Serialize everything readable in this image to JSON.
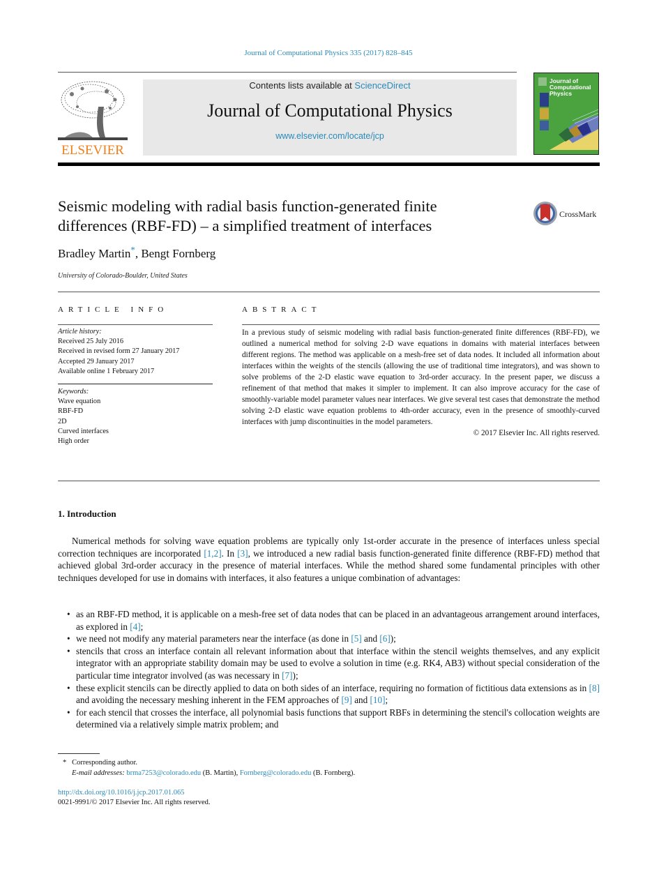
{
  "header": {
    "journal_ref": "Journal of Computational Physics 335 (2017) 828–845",
    "contents_prefix": "Contents lists available at ",
    "contents_link": "ScienceDirect",
    "journal_title": "Journal of Computational Physics",
    "journal_url": "www.elsevier.com/locate/jcp",
    "publisher_logo_text": "ELSEVIER",
    "cover_title_lines": [
      "Journal of",
      "Computational",
      "Physics"
    ],
    "publisher_color": "#f07f1a",
    "link_color": "#2a8ab8"
  },
  "article": {
    "title_line1": "Seismic modeling with radial basis function-generated finite",
    "title_line2": "differences (RBF-FD) – a simplified treatment of interfaces",
    "crossmark_label": "CrossMark",
    "author1": "Bradley Martin",
    "author_mark": "*",
    "author_sep": ", ",
    "author2": "Bengt Fornberg",
    "affiliation": "University of Colorado-Boulder, United States"
  },
  "article_info": {
    "heading": "ARTICLE INFO",
    "history_label": "Article history:",
    "history": [
      "Received 25 July 2016",
      "Received in revised form 27 January 2017",
      "Accepted 29 January 2017",
      "Available online 1 February 2017"
    ],
    "keywords_label": "Keywords:",
    "keywords": [
      "Wave equation",
      "RBF-FD",
      "2D",
      "Curved interfaces",
      "High order"
    ]
  },
  "abstract": {
    "heading": "ABSTRACT",
    "text": "In a previous study of seismic modeling with radial basis function-generated finite differences (RBF-FD), we outlined a numerical method for solving 2-D wave equations in domains with material interfaces between different regions. The method was applicable on a mesh-free set of data nodes. It included all information about interfaces within the weights of the stencils (allowing the use of traditional time integrators), and was shown to solve problems of the 2-D elastic wave equation to 3rd-order accuracy. In the present paper, we discuss a refinement of that method that makes it simpler to implement. It can also improve accuracy for the case of smoothly-variable model parameter values near interfaces. We give several test cases that demonstrate the method solving 2-D elastic wave equation problems to 4th-order accuracy, even in the presence of smoothly-curved interfaces with jump discontinuities in the model parameters.",
    "copyright": "© 2017 Elsevier Inc. All rights reserved."
  },
  "intro": {
    "heading": "1. Introduction",
    "p1_a": "Numerical methods for solving wave equation problems are typically only 1st-order accurate in the presence of interfaces unless special correction techniques are incorporated ",
    "p1_ref1": "[1,2]",
    "p1_b": ". In ",
    "p1_ref2": "[3]",
    "p1_c": ", we introduced a new radial basis function-generated finite difference (RBF-FD) method that achieved global 3rd-order accuracy in the presence of material interfaces. While the method shared some fundamental principles with other techniques developed for use in domains with interfaces, it also features a unique combination of advantages:",
    "bullet_char": "•",
    "b1_a": "as an RBF-FD method, it is applicable on a mesh-free set of data nodes that can be placed in an advantageous arrange­ment around interfaces, as explored in ",
    "b1_ref": "[4]",
    "b1_b": ";",
    "b2_a": "we need not modify any material parameters near the interface (as done in ",
    "b2_ref1": "[5]",
    "b2_b": " and ",
    "b2_ref2": "[6]",
    "b2_c": ");",
    "b3_a": "stencils that cross an interface contain all relevant information about that interface within the stencil weights them­selves, and any explicit integrator with an appropriate stability domain may be used to evolve a solution in time (e.g. RK4, AB3) without special consideration of the particular time integrator involved (as was necessary in ",
    "b3_ref": "[7]",
    "b3_b": ");",
    "b4_a": "these explicit stencils can be directly applied to data on both sides of an interface, requiring no formation of fictitious data extensions as in ",
    "b4_ref1": "[8]",
    "b4_b": " and avoiding the necessary meshing inherent in the FEM approaches of ",
    "b4_ref2": "[9]",
    "b4_c": " and ",
    "b4_ref3": "[10]",
    "b4_d": ";",
    "b5": "for each stencil that crosses the interface, all polynomial basis functions that support RBFs in determining the stencil's collocation weights are determined via a relatively simple matrix problem; and"
  },
  "footnote": {
    "mark": "*",
    "corresponding": "Corresponding author.",
    "email_label": "E-mail addresses:",
    "email1": "brma7253@colorado.edu",
    "email1_who": " (B. Martin), ",
    "email2": "Fornberg@colorado.edu",
    "email2_who": " (B. Fornberg)."
  },
  "doi": {
    "url": "http://dx.doi.org/10.1016/j.jcp.2017.01.065",
    "issn_line": "0021-9991/© 2017 Elsevier Inc. All rights reserved."
  }
}
